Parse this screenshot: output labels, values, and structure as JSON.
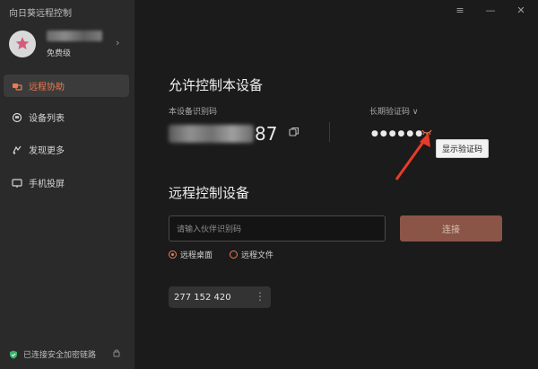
{
  "app": {
    "title": "向日葵远程控制"
  },
  "user": {
    "level": "免费级"
  },
  "sidebar": {
    "items": [
      {
        "label": "远程协助",
        "icon": "remote-assist-icon"
      },
      {
        "label": "设备列表",
        "icon": "device-list-icon"
      },
      {
        "label": "发现更多",
        "icon": "discover-icon"
      },
      {
        "label": "手机投屏",
        "icon": "screen-cast-icon"
      }
    ],
    "footer": {
      "status": "已连接安全加密链路"
    }
  },
  "main": {
    "allow_control": {
      "title": "允许控制本设备",
      "device_id_label": "本设备识别码",
      "device_id_tail": "87",
      "code_label": "长期验证码 ∨",
      "code_mask": "●●●●●●",
      "tooltip": "显示验证码"
    },
    "remote_control": {
      "title": "远程控制设备",
      "input_placeholder": "请输入伙伴识别码",
      "connect_label": "连接",
      "radio_desktop": "远程桌面",
      "radio_file": "远程文件",
      "recent_id": "277 152 420"
    }
  },
  "colors": {
    "accent": "#f07a4f",
    "sidebar_bg": "#2a2a2a",
    "main_bg": "#1b1b1b",
    "connect_bg": "#8a5546"
  }
}
